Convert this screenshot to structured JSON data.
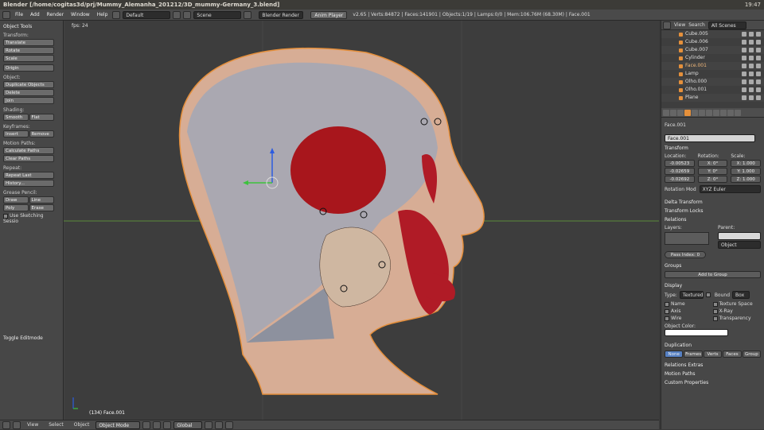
{
  "titlebar": {
    "title": "Blender [/home/cogitas3d/prj/Mummy_Alemanha_201212/3D_mummy-Germany_3.blend]",
    "time": "19:47"
  },
  "info": {
    "menus": [
      "File",
      "Add",
      "Render",
      "Window",
      "Help"
    ],
    "screen": "Default",
    "scene": "Scene",
    "engine": "Blender Render",
    "anim_player": "Anim Player",
    "stats": "v2.65 | Verts:84872 | Faces:141901 | Objects:1/19 | Lamps:0/0 | Mem:106.76M (68.30M) | Face.001"
  },
  "toolshelf": {
    "header": "Object Tools",
    "transform_label": "Transform:",
    "translate": "Translate",
    "rotate": "Rotate",
    "scale": "Scale",
    "origin": "Origin",
    "object_label": "Object:",
    "duplicate": "Duplicate Objects",
    "delete": "Delete",
    "join": "Join",
    "shading_label": "Shading:",
    "smooth": "Smooth",
    "flat": "Flat",
    "keyframes_label": "Keyframes:",
    "insert": "Insert",
    "remove": "Remove",
    "motion_label": "Motion Paths:",
    "calc_paths": "Calculate Paths",
    "clear_paths": "Clear Paths",
    "repeat_label": "Repeat:",
    "repeat_last": "Repeat Last",
    "history": "History...",
    "grease_label": "Grease Pencil:",
    "draw": "Draw",
    "line": "Line",
    "poly": "Poly",
    "erase": "Erase",
    "use_sketching": "Use Sketching Sessio",
    "toggle_editmode": "Toggle Editmode"
  },
  "viewport": {
    "fps": "fps: 24",
    "object_label": "(134) Face.001"
  },
  "footer": {
    "view": "View",
    "select": "Select",
    "object": "Object",
    "mode": "Object Mode",
    "orientation": "Global"
  },
  "outliner": {
    "view": "View",
    "search": "Search",
    "scenes": "All Scenes",
    "items": [
      "Cube.005",
      "Cube.006",
      "Cube.007",
      "Cylinder",
      "Face.001",
      "Lamp",
      "Olho.000",
      "Olho.001",
      "Plane"
    ]
  },
  "props": {
    "breadcrumb": "Face.001",
    "name": "Face.001",
    "transform": "Transform",
    "location": "Location:",
    "rotation": "Rotation:",
    "scale": "Scale:",
    "loc": [
      "-0.00523",
      "-0.02659",
      "-0.02692"
    ],
    "rot": [
      "X: 0°",
      "Y: 0°",
      "Z: 0°"
    ],
    "scl": [
      "X: 1.000",
      "Y: 1.000",
      "Z: 1.000"
    ],
    "rotation_mode_label": "Rotation Mod",
    "rotation_mode": "XYZ Euler",
    "delta": "Delta Transform",
    "locks": "Transform Locks",
    "relations": "Relations",
    "layers": "Layers:",
    "parent": "Parent:",
    "parent_type": "Object",
    "pass_index": "Pass Index: 0",
    "groups": "Groups",
    "add_group": "Add to Group",
    "display": "Display",
    "type_label": "Type:",
    "type": "Textured",
    "bound": "Bound",
    "box": "Box",
    "name_chk": "Name",
    "texspace": "Texture Space",
    "axis": "Axis",
    "xray": "X-Ray",
    "wire": "Wire",
    "transparency": "Transparency",
    "object_color": "Object Color:",
    "duplication": "Duplication",
    "dup_modes": [
      "None",
      "Frames",
      "Verts",
      "Faces",
      "Group"
    ],
    "relextras": "Relations Extras",
    "motion_paths": "Motion Paths",
    "custom": "Custom Properties"
  }
}
